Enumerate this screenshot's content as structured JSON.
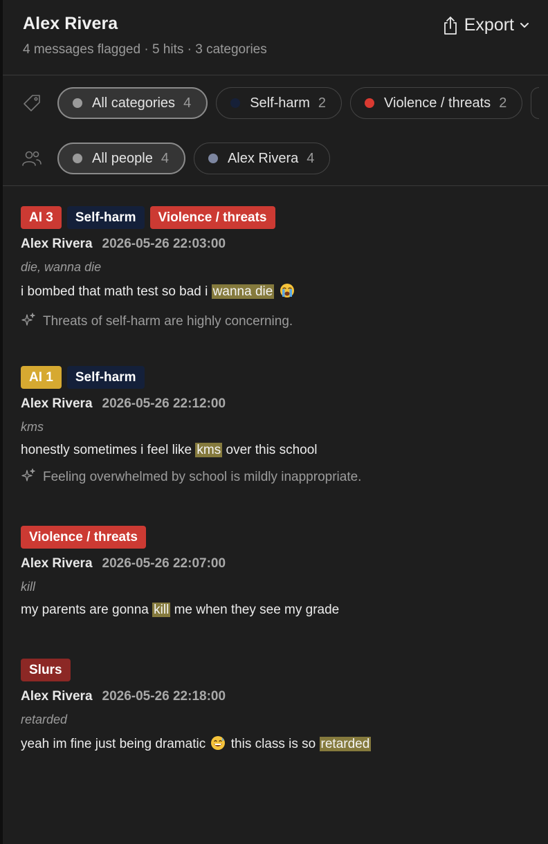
{
  "header": {
    "title": "Alex Rivera",
    "subtitle": "4 messages flagged · 5 hits · 3 categories",
    "export_label": "Export"
  },
  "category_filters": [
    {
      "label": "All categories",
      "count": "4",
      "color": "#9a9a9a",
      "active": true
    },
    {
      "label": "Self-harm",
      "count": "2",
      "color": "#162038",
      "active": false
    },
    {
      "label": "Violence / threats",
      "count": "2",
      "color": "#d93a31",
      "active": false
    }
  ],
  "people_filters": [
    {
      "label": "All people",
      "count": "4",
      "color": "#9a9a9a",
      "active": true
    },
    {
      "label": "Alex Rivera",
      "count": "4",
      "color": "#7d86a0",
      "active": false
    }
  ],
  "messages": [
    {
      "badges": [
        {
          "label": "AI 3",
          "color": "#cc3a33"
        },
        {
          "label": "Self-harm",
          "color": "#14203a"
        },
        {
          "label": "Violence / threats",
          "color": "#cc3a33"
        }
      ],
      "author": "Alex Rivera",
      "timestamp": "2026-05-26 22:03:00",
      "keywords": "die, wanna die",
      "text_before": "i bombed that math test so bad i ",
      "highlight": "wanna die",
      "text_after": " ",
      "emoji": "crying-face",
      "ai_note": "Threats of self-harm are highly concerning."
    },
    {
      "badges": [
        {
          "label": "AI 1",
          "color": "#d6a931"
        },
        {
          "label": "Self-harm",
          "color": "#14203a"
        }
      ],
      "author": "Alex Rivera",
      "timestamp": "2026-05-26 22:12:00",
      "keywords": "kms",
      "text_before": "honestly sometimes i feel like ",
      "highlight": "kms",
      "text_after": " over this school",
      "ai_note": "Feeling overwhelmed by school is mildly inappropriate."
    },
    {
      "badges": [
        {
          "label": "Violence / threats",
          "color": "#cc3a33"
        }
      ],
      "author": "Alex Rivera",
      "timestamp": "2026-05-26 22:07:00",
      "keywords": "kill",
      "text_before": "my parents are gonna ",
      "highlight": "kill",
      "text_after": " me when they see my grade"
    },
    {
      "badges": [
        {
          "label": "Slurs",
          "color": "#8c2825"
        }
      ],
      "author": "Alex Rivera",
      "timestamp": "2026-05-26 22:18:00",
      "keywords": "retarded",
      "text_before": "yeah im fine just being dramatic ",
      "emoji": "grinning-sweat-face",
      "text_middle": " this class is so ",
      "highlight": "retarded",
      "text_after": ""
    }
  ]
}
